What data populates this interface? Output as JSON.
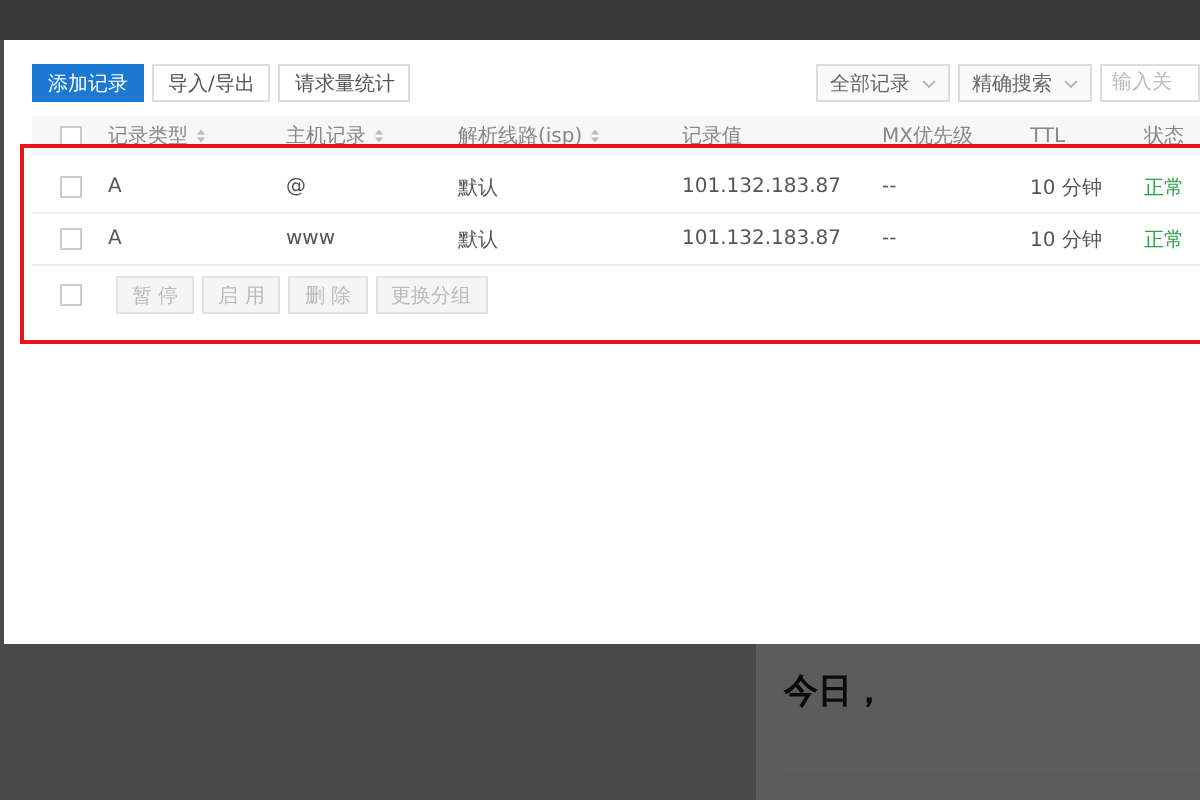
{
  "toolbar": {
    "buttons": [
      {
        "label": "添加记录",
        "kind": "primary"
      },
      {
        "label": "导入/导出",
        "kind": "default"
      },
      {
        "label": "请求量统计",
        "kind": "default"
      }
    ],
    "filters": [
      {
        "label": "全部记录"
      },
      {
        "label": "精确搜索"
      }
    ],
    "search": {
      "placeholder": "输入关"
    }
  },
  "table": {
    "columns": [
      {
        "label": "记录类型",
        "sortable": true
      },
      {
        "label": "主机记录",
        "sortable": true
      },
      {
        "label": "解析线路(isp)",
        "sortable": true
      },
      {
        "label": "记录值",
        "sortable": false
      },
      {
        "label": "MX优先级",
        "sortable": false
      },
      {
        "label": "TTL",
        "sortable": false
      },
      {
        "label": "状态",
        "sortable": false
      }
    ],
    "header_checked": false,
    "rows": [
      {
        "checked": false,
        "cells": [
          "A",
          "@",
          "默认",
          "101.132.183.87",
          "--",
          "10 分钟",
          "正常"
        ]
      },
      {
        "checked": false,
        "cells": [
          "A",
          "www",
          "默认",
          "101.132.183.87",
          "--",
          "10 分钟",
          "正常"
        ]
      }
    ],
    "footer_checked": false,
    "actions": [
      {
        "label": "暂 停",
        "disabled": true
      },
      {
        "label": "启 用",
        "disabled": true
      },
      {
        "label": "删 除",
        "disabled": true
      },
      {
        "label": "更换分组",
        "disabled": true
      }
    ]
  },
  "side_panel": {
    "heading": "今日，"
  }
}
